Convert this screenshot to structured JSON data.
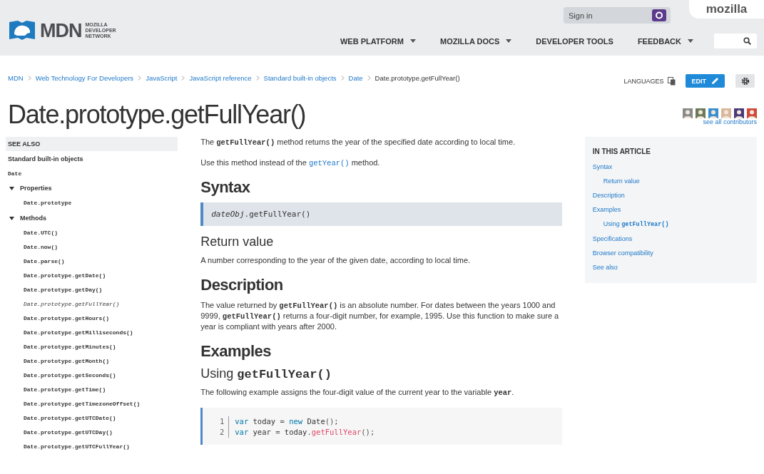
{
  "header": {
    "logo": {
      "wordmark": "MDN",
      "subtitle": "MOZILLA DEVELOPER NETWORK"
    },
    "sign_in": "Sign in",
    "brand": "mozilla",
    "nav": [
      {
        "label": "WEB PLATFORM",
        "dropdown": true
      },
      {
        "label": "MOZILLA DOCS",
        "dropdown": true
      },
      {
        "label": "DEVELOPER TOOLS",
        "dropdown": false
      },
      {
        "label": "FEEDBACK",
        "dropdown": true
      }
    ]
  },
  "breadcrumbs": [
    {
      "label": "MDN",
      "current": false
    },
    {
      "label": "Web Technology For Developers",
      "current": false
    },
    {
      "label": "JavaScript",
      "current": false
    },
    {
      "label": "JavaScript reference",
      "current": false
    },
    {
      "label": "Standard built-in objects",
      "current": false
    },
    {
      "label": "Date",
      "current": false
    },
    {
      "label": "Date.prototype.getFullYear()",
      "current": true
    }
  ],
  "toolbar": {
    "languages": "LANGUAGES",
    "edit": "EDIT"
  },
  "title": "Date.prototype.getFullYear()",
  "contributors": {
    "avatars": [
      {
        "color": "#8a8a8a"
      },
      {
        "color": "#6b7a5a"
      },
      {
        "color": "#3a8fd0"
      },
      {
        "color": "#d8b89a"
      },
      {
        "color": "#4a3a7a"
      },
      {
        "color": "#d04a3a"
      }
    ],
    "link": "see all contributors"
  },
  "sidebar": {
    "heading": "SEE ALSO",
    "link": "Standard built-in objects",
    "object": "Date",
    "groups": [
      {
        "label": "Properties",
        "expanded": true,
        "children": [
          {
            "label": "Date.prototype",
            "selected": false
          }
        ]
      },
      {
        "label": "Methods",
        "expanded": true,
        "children": [
          {
            "label": "Date.UTC()",
            "selected": false
          },
          {
            "label": "Date.now()",
            "selected": false
          },
          {
            "label": "Date.parse()",
            "selected": false
          },
          {
            "label": "Date.prototype.getDate()",
            "selected": false
          },
          {
            "label": "Date.prototype.getDay()",
            "selected": false
          },
          {
            "label": "Date.prototype.getFullYear()",
            "selected": true
          },
          {
            "label": "Date.prototype.getHours()",
            "selected": false
          },
          {
            "label": "Date.prototype.getMilliseconds()",
            "selected": false
          },
          {
            "label": "Date.prototype.getMinutes()",
            "selected": false
          },
          {
            "label": "Date.prototype.getMonth()",
            "selected": false
          },
          {
            "label": "Date.prototype.getSeconds()",
            "selected": false
          },
          {
            "label": "Date.prototype.getTime()",
            "selected": false
          },
          {
            "label": "Date.prototype.getTimezoneOffset()",
            "selected": false
          },
          {
            "label": "Date.prototype.getUTCDate()",
            "selected": false
          },
          {
            "label": "Date.prototype.getUTCDay()",
            "selected": false
          },
          {
            "label": "Date.prototype.getUTCFullYear()",
            "selected": false
          }
        ]
      }
    ]
  },
  "article": [
    {
      "kind": "paragraph",
      "parts": [
        {
          "kind": "text",
          "text": "The "
        },
        {
          "kind": "code",
          "text": "getFullYear()"
        },
        {
          "kind": "text",
          "text": " method returns the year of the specified date according to local time."
        }
      ]
    },
    {
      "kind": "paragraph",
      "parts": [
        {
          "kind": "text",
          "text": "Use this method instead of the "
        },
        {
          "kind": "codelink",
          "text": "getYear()"
        },
        {
          "kind": "text",
          "text": " method."
        }
      ]
    },
    {
      "kind": "h2",
      "text": "Syntax"
    },
    {
      "kind": "syntax",
      "parts": [
        {
          "kind": "italic",
          "text": "dateObj"
        },
        {
          "kind": "text",
          "text": ".getFullYear()"
        }
      ]
    },
    {
      "kind": "h3",
      "text": "Return value"
    },
    {
      "kind": "paragraph",
      "parts": [
        {
          "kind": "text",
          "text": "A number corresponding to the year of the given date, according to local time."
        }
      ]
    },
    {
      "kind": "h2",
      "text": "Description"
    },
    {
      "kind": "paragraph",
      "parts": [
        {
          "kind": "text",
          "text": "The value returned by "
        },
        {
          "kind": "code",
          "text": "getFullYear()"
        },
        {
          "kind": "text",
          "text": " is an absolute number. For dates between the years 1000 and 9999, "
        },
        {
          "kind": "code",
          "text": "getFullYear()"
        },
        {
          "kind": "text",
          "text": " returns a four-digit number, for example, 1995. Use this function to make sure a year is compliant with years after 2000."
        }
      ]
    },
    {
      "kind": "h2",
      "text": "Examples"
    },
    {
      "kind": "h3",
      "parts": [
        {
          "kind": "text",
          "text": "Using "
        },
        {
          "kind": "code",
          "text": "getFullYear()"
        }
      ]
    },
    {
      "kind": "paragraph",
      "parts": [
        {
          "kind": "text",
          "text": "The following example assigns the four-digit value of the current year to the variable "
        },
        {
          "kind": "code",
          "text": "year"
        },
        {
          "kind": "text",
          "text": "."
        }
      ]
    },
    {
      "kind": "code_block",
      "lines": [
        {
          "number": "1",
          "tokens": [
            {
              "kind": "keyword",
              "text": "var"
            },
            {
              "kind": "plain",
              "text": " today "
            },
            {
              "kind": "punct",
              "text": "="
            },
            {
              "kind": "keyword",
              "text": " new"
            },
            {
              "kind": "plain",
              "text": " Date"
            },
            {
              "kind": "punct",
              "text": "();"
            }
          ]
        },
        {
          "number": "2",
          "tokens": [
            {
              "kind": "keyword",
              "text": "var"
            },
            {
              "kind": "plain",
              "text": " year "
            },
            {
              "kind": "punct",
              "text": "="
            },
            {
              "kind": "plain",
              "text": " today"
            },
            {
              "kind": "punct",
              "text": "."
            },
            {
              "kind": "method",
              "text": "getFullYear"
            },
            {
              "kind": "punct",
              "text": "();"
            }
          ]
        }
      ]
    }
  ],
  "toc": {
    "heading": "IN THIS ARTICLE",
    "items": [
      {
        "parts": [
          {
            "kind": "text",
            "text": "Syntax"
          }
        ],
        "children": [
          {
            "parts": [
              {
                "kind": "text",
                "text": "Return value"
              }
            ]
          }
        ]
      },
      {
        "parts": [
          {
            "kind": "text",
            "text": "Description"
          }
        ]
      },
      {
        "parts": [
          {
            "kind": "text",
            "text": "Examples"
          }
        ],
        "children": [
          {
            "parts": [
              {
                "kind": "text",
                "text": "Using "
              },
              {
                "kind": "code",
                "text": "getFullYear()"
              }
            ]
          }
        ]
      },
      {
        "parts": [
          {
            "kind": "text",
            "text": "Specifications"
          }
        ]
      },
      {
        "parts": [
          {
            "kind": "text",
            "text": "Browser compatibility"
          }
        ]
      },
      {
        "parts": [
          {
            "kind": "text",
            "text": "See also"
          }
        ]
      }
    ]
  }
}
